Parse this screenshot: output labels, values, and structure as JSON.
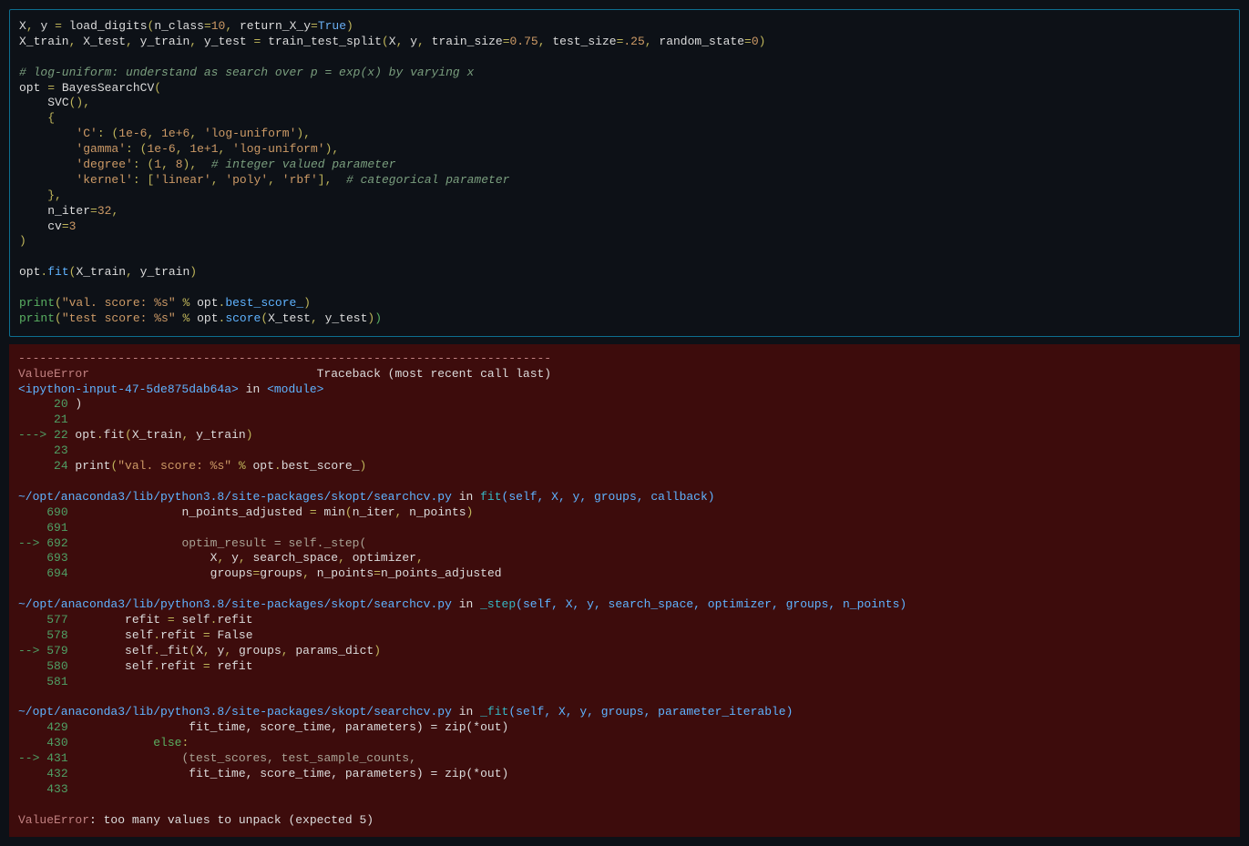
{
  "code": {
    "l1": "X, y = load_digits(n_class=10, return_X_y=True)",
    "l2": "X_train, X_test, y_train, y_test = train_test_split(X, y, train_size=0.75, test_size=.25, random_state=0)",
    "l3": "",
    "l4": "# log-uniform: understand as search over p = exp(x) by varying x",
    "l5": "opt = BayesSearchCV(",
    "l6": "    SVC(),",
    "l7": "    {",
    "l8": "        'C': (1e-6, 1e+6, 'log-uniform'),",
    "l9": "        'gamma': (1e-6, 1e+1, 'log-uniform'),",
    "l10": "        'degree': (1, 8),  # integer valued parameter",
    "l11": "        'kernel': ['linear', 'poly', 'rbf'],  # categorical parameter",
    "l12": "    },",
    "l13": "    n_iter=32,",
    "l14": "    cv=3",
    "l15": ")",
    "l16": "",
    "l17": "opt.fit(X_train, y_train)",
    "l18": "",
    "l19": "print(\"val. score: %s\" % opt.best_score_)",
    "l20": "print(\"test score: %s\" % opt.score(X_test, y_test))"
  },
  "err": {
    "sep": "---------------------------------------------------------------------------",
    "name": "ValueError",
    "tb_label": "Traceback (most recent call last)",
    "loc0": "<ipython-input-47-5de875dab64a>",
    "in": "in",
    "mod": "<module>",
    "l20n": "20",
    "l20": " )",
    "l21n": "21",
    "l22n": "22",
    "l22a": " opt",
    "l22b": ".",
    "l22c": "fit",
    "l22d": "(",
    "l22e": "X_train",
    "l22f": ",",
    "l22g": " y_train",
    "l22h": ")",
    "l23n": "23",
    "l24n": "24",
    "l24a": " print",
    "l24b": "(",
    "l24c": "\"val. score: %s\"",
    "l24d": " %",
    "l24e": " opt",
    "l24f": ".",
    "l24g": "best_score_",
    "l24h": ")",
    "path1": "~/opt/anaconda3/lib/python3.8/site-packages/skopt/searchcv.py",
    "fn1": "fit",
    "sig1": "(self, X, y, groups, callback)",
    "l690n": "690",
    "l690": "                n_points_adjusted = min(n_iter, n_points)",
    "l691n": "691",
    "l692n": "692",
    "l692": "                optim_result = self._step(",
    "l693n": "693",
    "l693": "                    X, y, search_space, optimizer,",
    "l694n": "694",
    "l694": "                    groups=groups, n_points=n_points_adjusted",
    "fn2": "_step",
    "sig2": "(self, X, y, search_space, optimizer, groups, n_points)",
    "l577n": "577",
    "l577": "        refit = self.refit",
    "l578n": "578",
    "l578": "        self.refit = False",
    "l579n": "579",
    "l579": "        self._fit(X, y, groups, params_dict)",
    "l580n": "580",
    "l580": "        self.refit = refit",
    "l581n": "581",
    "fn3": "_fit",
    "sig3": "(self, X, y, groups, parameter_iterable)",
    "l429n": "429",
    "l429": "                 fit_time, score_time, parameters) = zip(*out)",
    "l430n": "430",
    "l430": "            else:",
    "l431n": "431",
    "l431": "                (test_scores, test_sample_counts,",
    "l432n": "432",
    "l432": "                 fit_time, score_time, parameters) = zip(*out)",
    "l433n": "433",
    "final": "ValueError",
    "final_msg": ": too many values to unpack (expected 5)",
    "arrow": "---> ",
    "arrow2": "--> ",
    "pad5": "     ",
    "pad4": "    "
  }
}
